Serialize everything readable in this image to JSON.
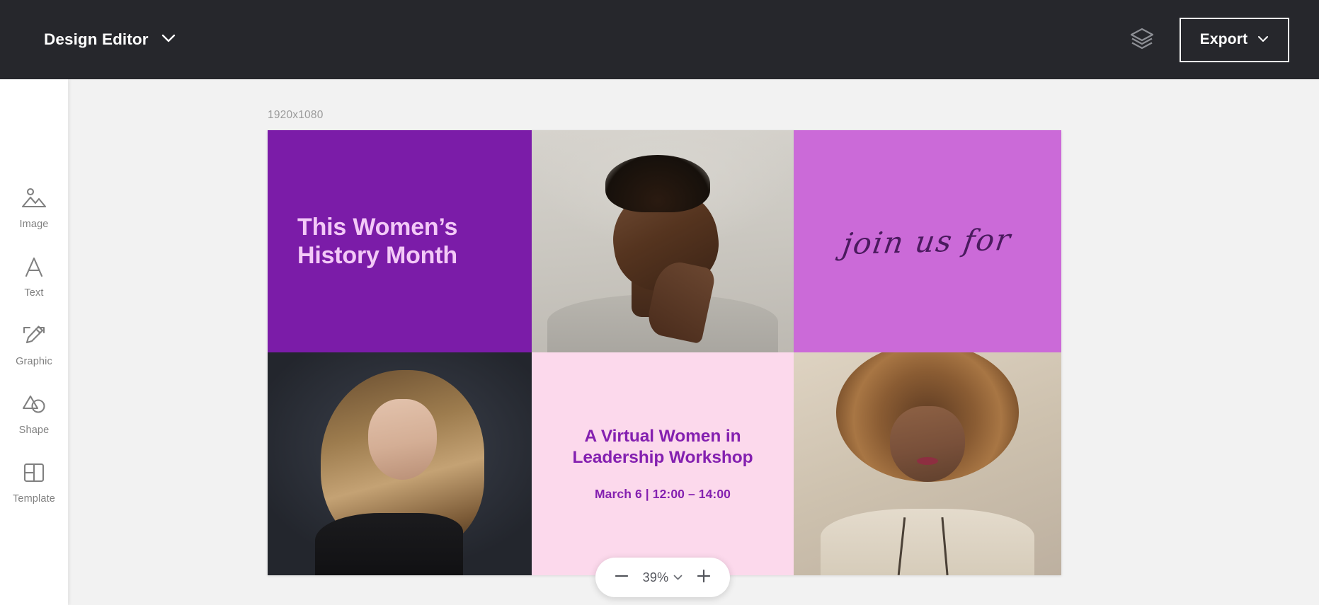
{
  "header": {
    "title": "Design Editor",
    "title_caret_icon": "chevron-down-icon",
    "layers_icon": "layers-icon",
    "export_label": "Export",
    "export_caret_icon": "chevron-down-icon",
    "background_color": "#26272c"
  },
  "sidebar": {
    "items": [
      {
        "label": "Image",
        "icon": "image-icon"
      },
      {
        "label": "Text",
        "icon": "text-icon"
      },
      {
        "label": "Graphic",
        "icon": "graphic-pencil-icon"
      },
      {
        "label": "Shape",
        "icon": "shape-icon"
      },
      {
        "label": "Template",
        "icon": "template-grid-icon"
      }
    ]
  },
  "workspace": {
    "canvas_size_label": "1920x1080",
    "background_color": "#f2f2f2"
  },
  "design": {
    "cells": [
      {
        "name": "headline-panel",
        "type": "text",
        "background_color": "#7b1ca8",
        "text_color": "#f3c9f7",
        "line1": "This Women’s",
        "line2": "History Month"
      },
      {
        "name": "photo-portrait-looking-up",
        "type": "image",
        "background_color": "#c9c6c0"
      },
      {
        "name": "script-panel",
        "type": "text",
        "background_color": "#cb6ad8",
        "text_color": "#4a1a5e",
        "text": "join us for"
      },
      {
        "name": "photo-blonde-dark-background",
        "type": "image",
        "background_color": "#2b2f38"
      },
      {
        "name": "event-info-panel",
        "type": "text",
        "background_color": "#fcd9ec",
        "text_color": "#8420b0",
        "title_line1": "A Virtual Women in",
        "title_line2": "Leadership Workshop",
        "date": "March 6 | 12:00 – 14:00"
      },
      {
        "name": "photo-curly-hair",
        "type": "image",
        "background_color": "#cfc3b2"
      }
    ]
  },
  "zoom_control": {
    "zoom_out_icon": "minus-icon",
    "zoom_in_icon": "plus-icon",
    "value": "39%",
    "caret_icon": "chevron-down-icon"
  }
}
